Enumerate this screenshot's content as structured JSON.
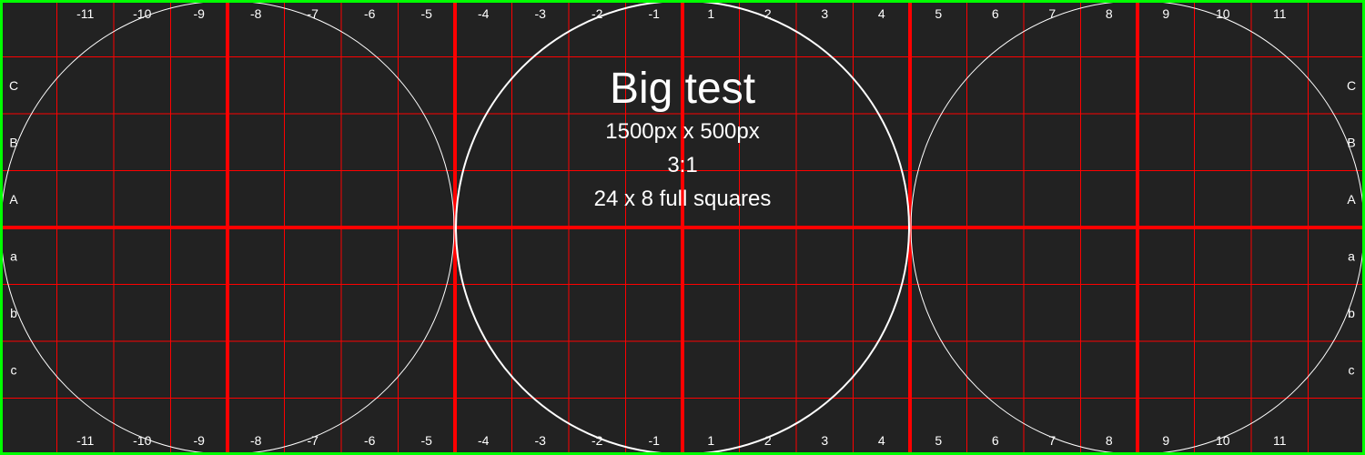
{
  "info": {
    "title": "Big test",
    "dimensions": "1500px x 500px",
    "ratio": "3:1",
    "squares": "24 x 8 full squares"
  },
  "column_labels": [
    "-11",
    "-10",
    "-9",
    "-8",
    "-7",
    "-6",
    "-5",
    "-4",
    "-3",
    "-2",
    "-1",
    "1",
    "2",
    "3",
    "4",
    "5",
    "6",
    "7",
    "8",
    "9",
    "10",
    "11"
  ],
  "row_labels": [
    "C",
    "B",
    "A",
    "a",
    "b",
    "c"
  ],
  "colors": {
    "background": "#222222",
    "grid_line": "#ff0000",
    "circle": "#ffffff",
    "border": "#00ff00",
    "text": "#ffffff"
  }
}
